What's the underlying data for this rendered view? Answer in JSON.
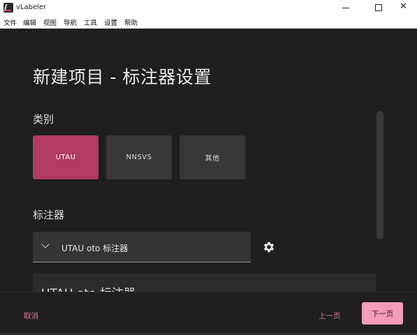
{
  "window": {
    "title": "vLabeler",
    "close_glyph": "✕"
  },
  "menu": [
    "文件",
    "编辑",
    "视图",
    "导航",
    "工具",
    "设置",
    "帮助"
  ],
  "page": {
    "title": "新建项目 - 标注器设置"
  },
  "category": {
    "label": "类别",
    "options": [
      "UTAU",
      "NNSVS",
      "其他"
    ],
    "selected": "UTAU"
  },
  "labeler": {
    "label": "标注器",
    "selected_value": "UTAU oto 标注器",
    "card_title": "UTAU oto 标注器"
  },
  "footer": {
    "cancel": "取消",
    "previous": "上一页",
    "next": "下一页"
  },
  "colors": {
    "accent": "#b23a63",
    "accent_light": "#f49bb9",
    "text_accent": "#e0749a",
    "background": "#1f1f1f"
  },
  "icons": {
    "app": "vlabeler-logo-icon",
    "dropdown": "chevron-down-icon",
    "settings": "gear-icon"
  }
}
